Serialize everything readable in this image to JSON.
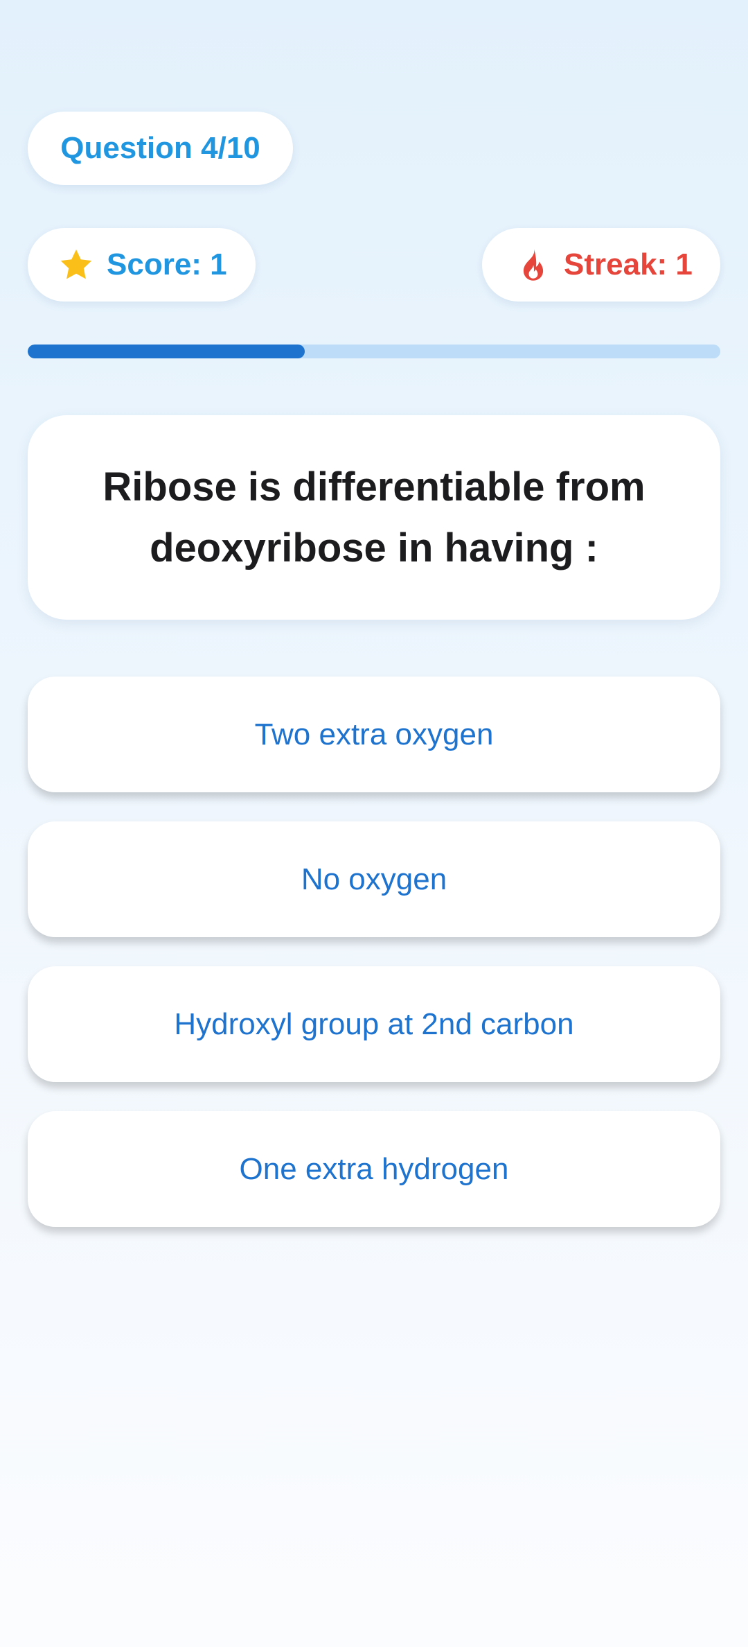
{
  "header": {
    "question_counter": "Question 4/10",
    "score_label": "Score: 1",
    "streak_label": "Streak: 1"
  },
  "progress": {
    "fraction": 0.4
  },
  "question": {
    "text": "Ribose is differentiable from deoxyribose in having :"
  },
  "answers": [
    {
      "label": "Two extra oxygen"
    },
    {
      "label": "No oxygen"
    },
    {
      "label": "Hydroxyl group at 2nd carbon"
    },
    {
      "label": "One extra hydrogen"
    }
  ],
  "icons": {
    "score": "star-icon",
    "streak": "flame-icon"
  },
  "colors": {
    "accent_blue": "#2196e0",
    "answer_blue": "#1e73cf",
    "streak_red": "#e5453a",
    "star_yellow": "#fbbf1a",
    "progress_fill": "#1e73cf",
    "progress_track": "#bcdcf7"
  }
}
